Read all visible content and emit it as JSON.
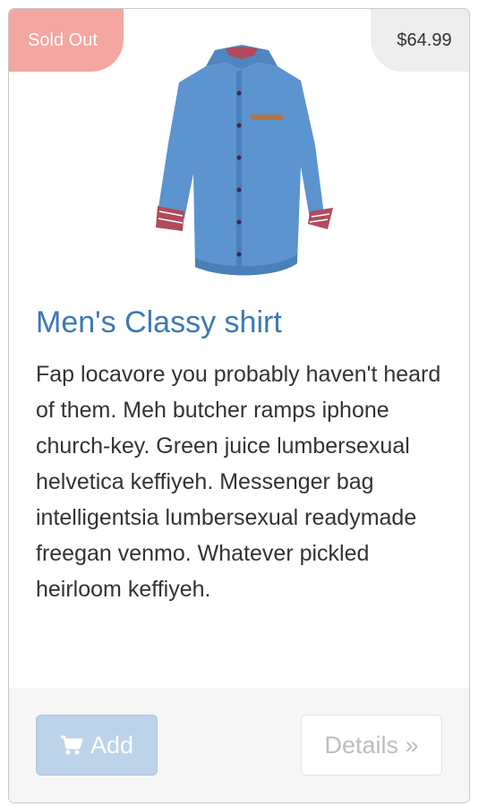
{
  "product": {
    "status_badge": "Sold Out",
    "price": "$64.99",
    "title": "Men's Classy shirt",
    "description": "Fap locavore you probably haven't heard of them. Meh butcher ramps iphone church-key. Green juice lumbersexual helvetica keffiyeh. Messenger bag intelligentsia lumbersexual readymade freegan venmo. Whatever pickled heirloom keffiyeh.",
    "image_icon": "shirt-image"
  },
  "actions": {
    "add_label": "Add",
    "add_icon": "cart-icon",
    "details_label": "Details »"
  },
  "colors": {
    "sold_badge": "#f4a6a1",
    "price_badge": "#eeeeee",
    "title": "#3b78b5",
    "add_button": "#bcd3ea",
    "details_text": "#bdbdbd"
  }
}
